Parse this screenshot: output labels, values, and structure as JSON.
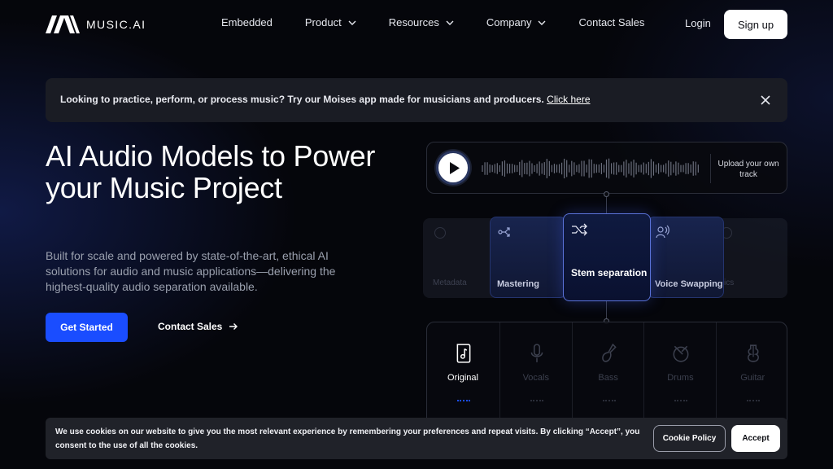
{
  "brand": {
    "name": "MUSIC.AI"
  },
  "nav": {
    "items": [
      {
        "label": "Embedded",
        "has_dropdown": false
      },
      {
        "label": "Product",
        "has_dropdown": true
      },
      {
        "label": "Resources",
        "has_dropdown": true
      },
      {
        "label": "Company",
        "has_dropdown": true
      },
      {
        "label": "Contact Sales",
        "has_dropdown": false
      }
    ],
    "login_label": "Login",
    "signup_label": "Sign up"
  },
  "banner": {
    "text": "Looking to practice, perform, or process music? Try our Moises app made for musicians and producers. ",
    "link_label": "Click here"
  },
  "hero": {
    "title": "AI Audio Models to Power your Music Project",
    "subtitle": "Built for scale and powered by state-of-the-art, ethical AI solutions for audio and music applications—delivering the highest-quality audio separation available.",
    "primary_cta": "Get Started",
    "secondary_cta": "Contact Sales"
  },
  "player": {
    "upload_label": "Upload your own track"
  },
  "models": {
    "faded_left": "Metadata",
    "cards": [
      {
        "label": "Mastering",
        "icon": "share-icon"
      },
      {
        "label": "Stem separation",
        "icon": "split-arrows-icon",
        "active": true
      },
      {
        "label": "Voice Swapping",
        "icon": "voice-icon"
      }
    ],
    "faded_right": "ics"
  },
  "stems": [
    {
      "label": "Original",
      "icon": "music-file-icon",
      "active": true
    },
    {
      "label": "Vocals",
      "icon": "microphone-icon",
      "active": false
    },
    {
      "label": "Bass",
      "icon": "bass-guitar-icon",
      "active": false
    },
    {
      "label": "Drums",
      "icon": "drum-icon",
      "active": false
    },
    {
      "label": "Guitar",
      "icon": "guitar-icon",
      "active": false
    }
  ],
  "cookie": {
    "text": "We use cookies on our website to give you the most relevant experience by remembering your preferences and repeat visits. By clicking “Accept”, you consent to the use of all the cookies.",
    "policy_label": "Cookie Policy",
    "accept_label": "Accept"
  },
  "colors": {
    "background": "#05060b",
    "primary": "#1a4dff",
    "active_stem": "#ffffff",
    "inactive_stem": "#3c404e"
  }
}
